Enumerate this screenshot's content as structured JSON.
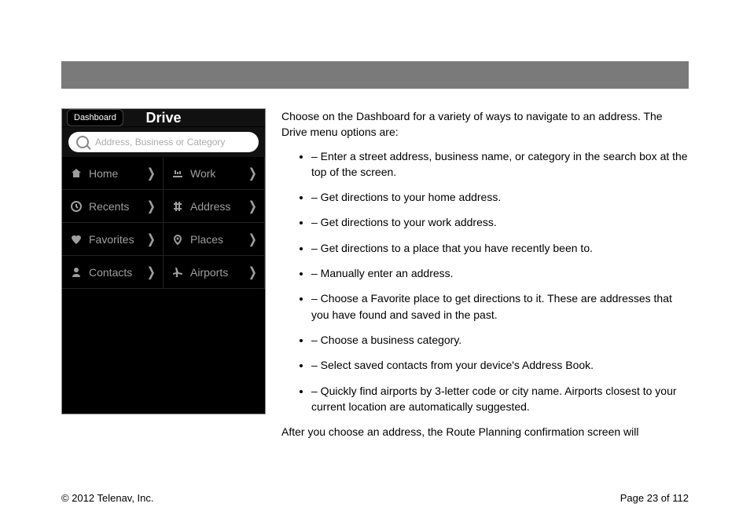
{
  "phone": {
    "dashboard_btn": "Dashboard",
    "title": "Drive",
    "search_placeholder": "Address, Business or Category",
    "items": [
      {
        "label": "Home",
        "icon": "home"
      },
      {
        "label": "Work",
        "icon": "work"
      },
      {
        "label": "Recents",
        "icon": "clock"
      },
      {
        "label": "Address",
        "icon": "address"
      },
      {
        "label": "Favorites",
        "icon": "heart"
      },
      {
        "label": "Places",
        "icon": "pin"
      },
      {
        "label": "Contacts",
        "icon": "contact"
      },
      {
        "label": "Airports",
        "icon": "plane"
      }
    ]
  },
  "body": {
    "intro_1": "Choose ",
    "intro_2": " on the Dashboard for a variety of ways to navigate to an address. The Drive menu options are:",
    "bullets": [
      " – Enter a street address, business name, or category in the search box at the top of the screen.",
      " – Get directions to your home address.",
      " – Get directions to your work address.",
      " – Get directions to a place that you have recently been to.",
      " – Manually enter an address.",
      " – Choose a Favorite place to get directions to it. These are addresses that you have found and saved in the past.",
      " – Choose a business category.",
      " – Select saved contacts from your device's Address Book.",
      " – Quickly find airports by 3-letter code or city name. Airports closest to your current location are automatically suggested."
    ],
    "outro": "After you choose an address, the Route Planning confirmation screen will"
  },
  "footer": {
    "copyright": "© 2012 Telenav, Inc.",
    "page": "Page 23 of 112"
  }
}
